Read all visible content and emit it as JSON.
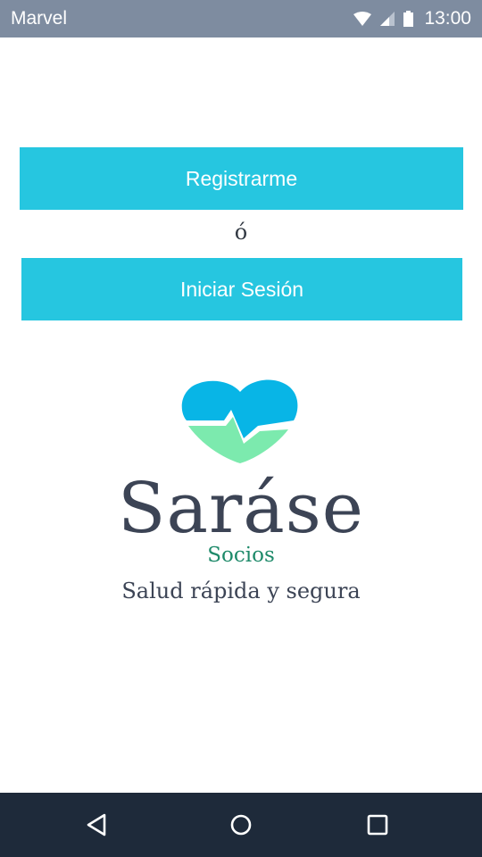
{
  "status_bar": {
    "carrier": "Marvel",
    "time": "13:00",
    "icons": [
      "wifi-icon",
      "signal-icon",
      "battery-icon"
    ]
  },
  "actions": {
    "register_label": "Registrarme",
    "separator": "ó",
    "login_label": "Iniciar Sesión"
  },
  "brand": {
    "logo_icon": "heart-pulse-icon",
    "name": "Saráse",
    "subtitle": "Socios",
    "tagline": "Salud rápida y segura"
  },
  "nav_bar": {
    "icons": [
      "back-icon",
      "home-icon",
      "recents-icon"
    ]
  },
  "colors": {
    "status_bar": "#7e8ca0",
    "button": "#26c6e0",
    "brand_text": "#3c4455",
    "subtitle": "#1e8a6a",
    "heart_top": "#08b5e6",
    "heart_bottom": "#7ceaae",
    "nav_bar": "#1e2a3a"
  }
}
